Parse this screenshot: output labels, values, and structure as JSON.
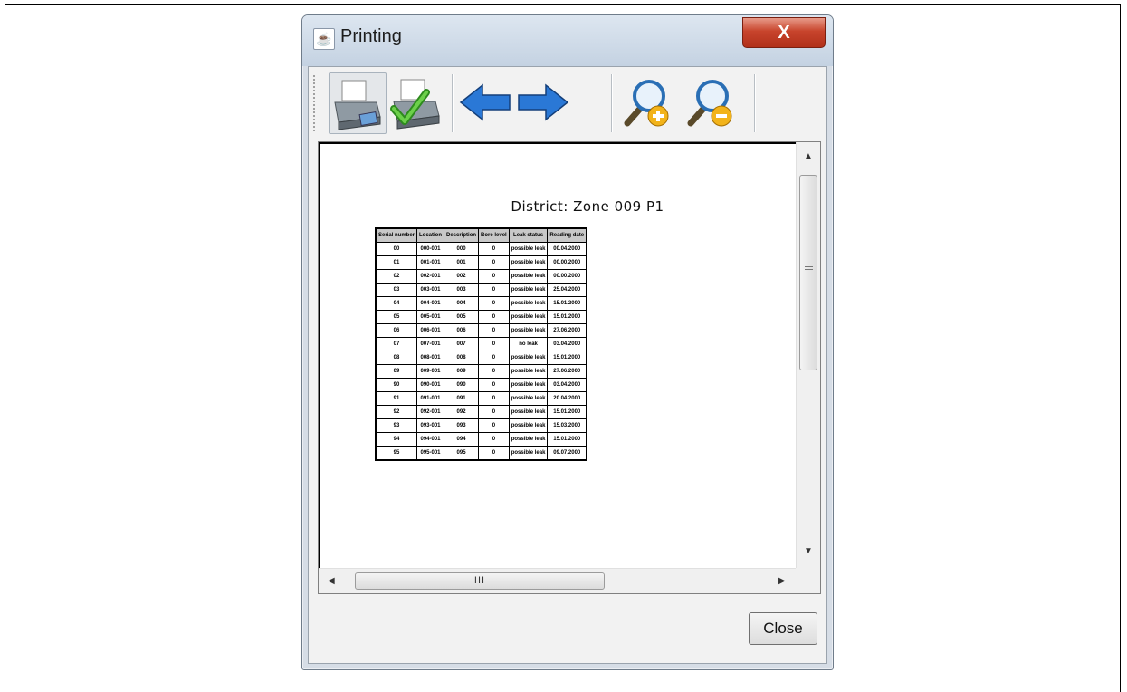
{
  "window": {
    "title": "Printing",
    "close_glyph": "X",
    "icon": "java-cup-icon"
  },
  "toolbar": {
    "buttons": [
      {
        "name": "print-icon"
      },
      {
        "name": "print-confirm-icon"
      },
      {
        "name": "arrow-left-icon"
      },
      {
        "name": "arrow-right-icon"
      },
      {
        "name": "zoom-in-icon"
      },
      {
        "name": "zoom-out-icon"
      }
    ]
  },
  "report": {
    "title": "District: Zone 009 P1",
    "columns": [
      "Serial number",
      "Location",
      "Description",
      "Bore level",
      "Leak status",
      "Reading date"
    ],
    "rows": [
      [
        "00",
        "000-001",
        "000",
        "0",
        "possible leak",
        "00.04.2000"
      ],
      [
        "01",
        "001-001",
        "001",
        "0",
        "possible leak",
        "00.00.2000"
      ],
      [
        "02",
        "002-001",
        "002",
        "0",
        "possible leak",
        "00.00.2000"
      ],
      [
        "03",
        "003-001",
        "003",
        "0",
        "possible leak",
        "25.04.2000"
      ],
      [
        "04",
        "004-001",
        "004",
        "0",
        "possible leak",
        "15.01.2000"
      ],
      [
        "05",
        "005-001",
        "005",
        "0",
        "possible leak",
        "15.01.2000"
      ],
      [
        "06",
        "006-001",
        "006",
        "0",
        "possible leak",
        "27.06.2000"
      ],
      [
        "07",
        "007-001",
        "007",
        "0",
        "no leak",
        "03.04.2000"
      ],
      [
        "08",
        "008-001",
        "008",
        "0",
        "possible leak",
        "15.01.2000"
      ],
      [
        "09",
        "009-001",
        "009",
        "0",
        "possible leak",
        "27.06.2000"
      ],
      [
        "90",
        "090-001",
        "090",
        "0",
        "possible leak",
        "03.04.2000"
      ],
      [
        "91",
        "091-001",
        "091",
        "0",
        "possible leak",
        "20.04.2000"
      ],
      [
        "92",
        "092-001",
        "092",
        "0",
        "possible leak",
        "15.01.2000"
      ],
      [
        "93",
        "093-001",
        "093",
        "0",
        "possible leak",
        "15.03.2000"
      ],
      [
        "94",
        "094-001",
        "094",
        "0",
        "possible leak",
        "15.01.2000"
      ],
      [
        "95",
        "095-001",
        "095",
        "0",
        "possible leak",
        "09.07.2000"
      ]
    ]
  },
  "scroll": {
    "h_thumb_grip": "III"
  },
  "footer": {
    "close_label": "Close"
  },
  "colors": {
    "titlebar": "#c4d2e2",
    "close_button": "#c8442c",
    "dialog_bg": "#d6dde6",
    "header_cell": "#c8c8c8"
  }
}
